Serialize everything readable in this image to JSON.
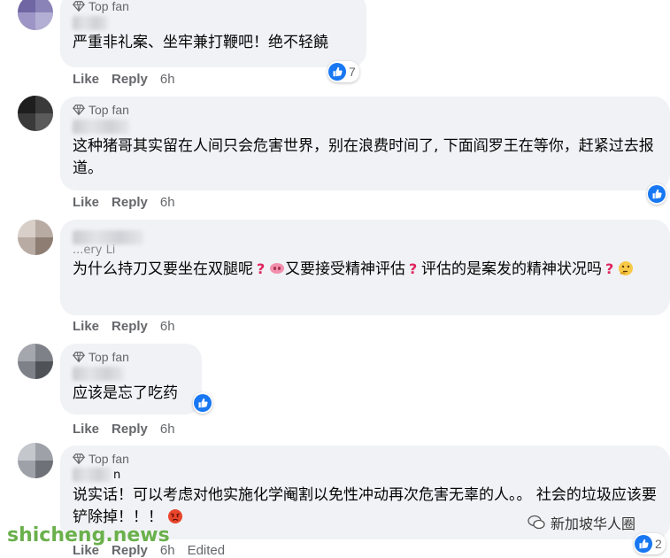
{
  "badge_label": "Top fan",
  "action_labels": {
    "like": "Like",
    "reply": "Reply"
  },
  "comments": [
    {
      "badge": "Top fan",
      "text": "严重非礼案、坐牢兼打鞭吧！绝不轻饒",
      "reaction_count": "7",
      "time": "6h"
    },
    {
      "badge": "Top fan",
      "text": "这种猪哥其实留在人间只会危害世界，别在浪费时间了, 下面阎罗王在等你，赶紧过去报道。",
      "time": "6h"
    },
    {
      "badge": "",
      "name_partial": "...ery Li",
      "text_part1": "为什么持刀又要坐在双腿呢",
      "text_part2": "又要接受精神评估",
      "text_part3": "评估的是案发的精神状况吗",
      "time": "6h"
    },
    {
      "badge": "Top fan",
      "text": "应该是忘了吃药",
      "time": "6h"
    },
    {
      "badge": "Top fan",
      "name_partial": "n",
      "text": "说实话！可以考虑对他实施化学阉割以免性冲动再次危害无辜的人。。 社会的垃圾应该要铲除掉！！！",
      "reaction_count": "2",
      "time": "6h",
      "edited": "Edited"
    }
  ],
  "watermark": "shicheng.news",
  "source_tag": "新加坡华人圈",
  "colors": {
    "bubble": "#f0f2f5",
    "like_blue": "#1877f2",
    "meta_gray": "#65676b"
  }
}
